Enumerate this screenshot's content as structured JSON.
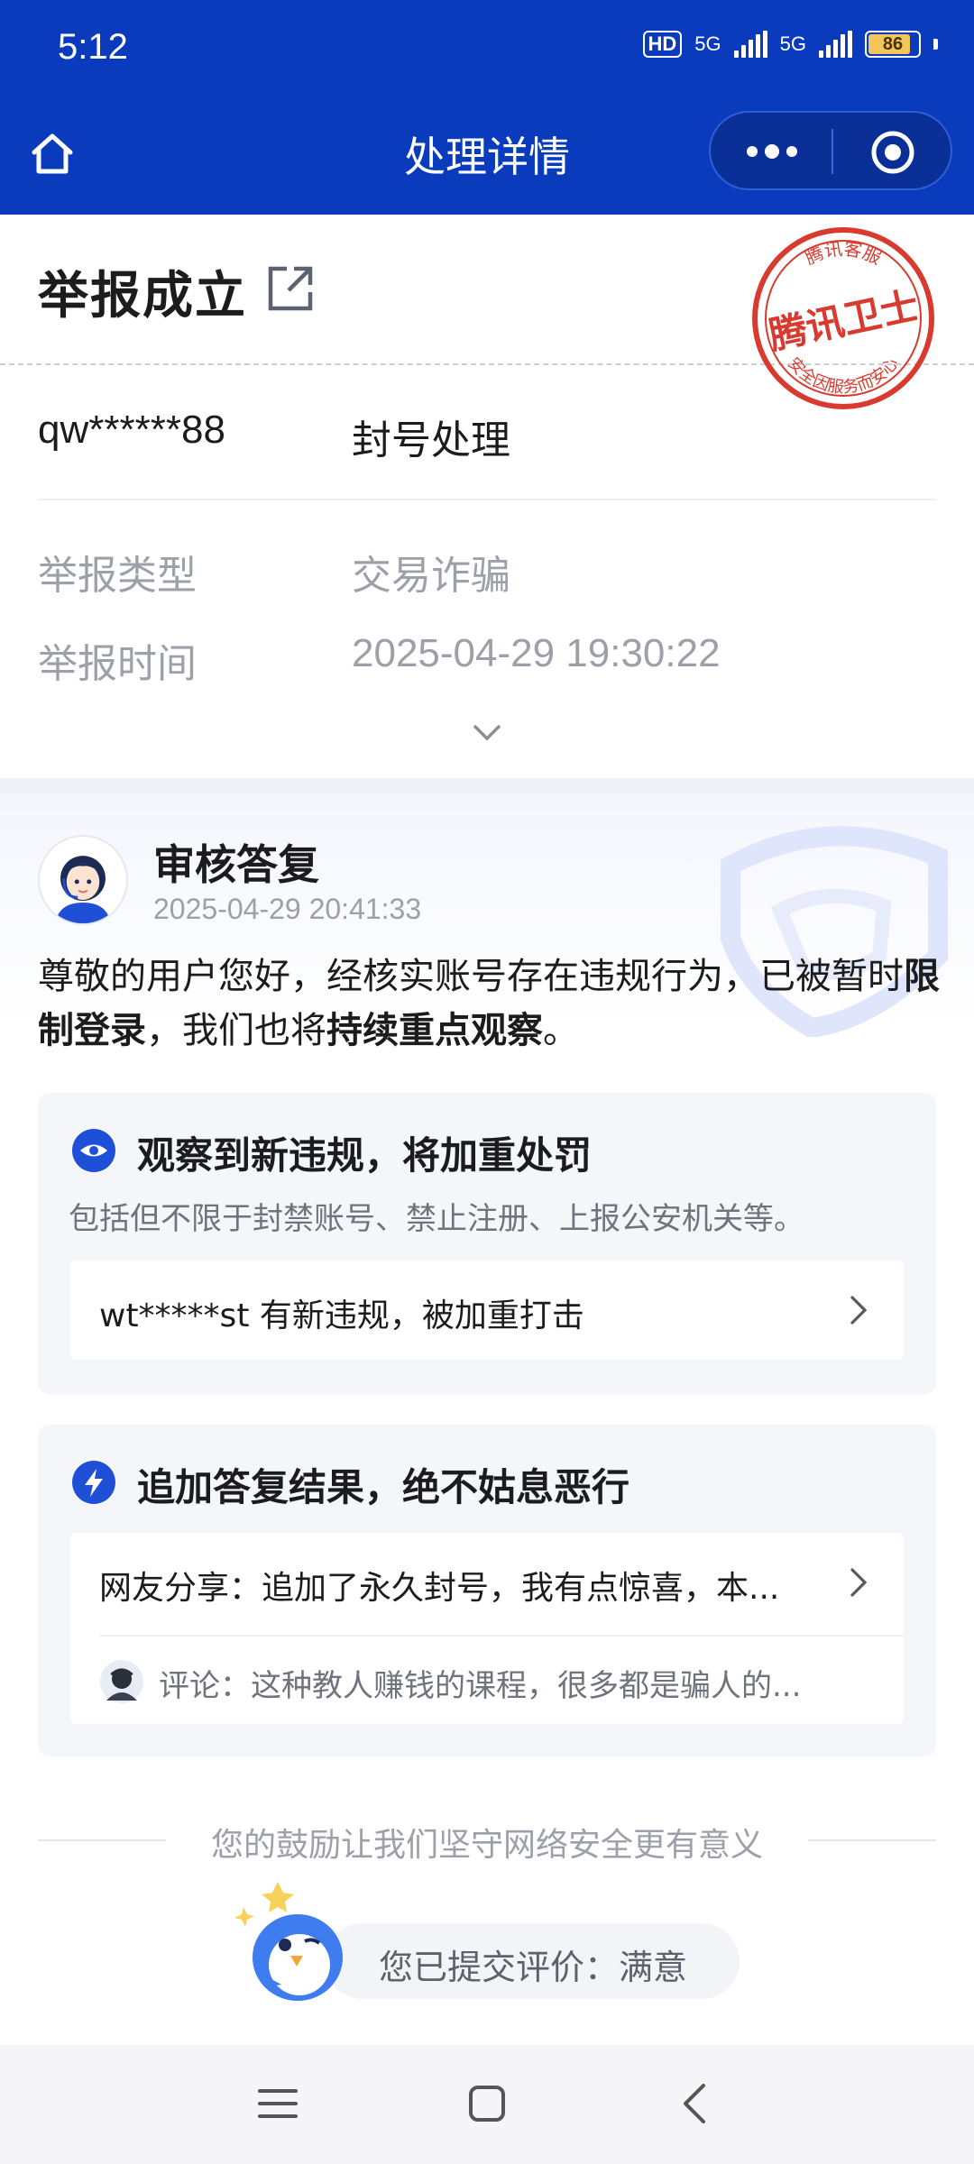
{
  "status_bar": {
    "time": "5:12",
    "hd": "HD",
    "net1": "5G",
    "net2": "5G",
    "battery": "86",
    "battery_level": 0.86
  },
  "nav": {
    "title": "处理详情"
  },
  "header": {
    "title": "举报成立",
    "seal_top": "腾讯客服",
    "seal_main": "腾讯卫士",
    "seal_bottom": "安全因服务而安心",
    "account": "qw******88",
    "action": "封号处理",
    "rows": [
      {
        "label": "举报类型",
        "value": "交易诈骗"
      },
      {
        "label": "举报时间",
        "value": "2025-04-29 19:30:22"
      }
    ]
  },
  "review": {
    "title": "审核答复",
    "time": "2025-04-29 20:41:33",
    "msg_part1": "尊敬的用户您好，经核实账号存在违规行为，已被暂时",
    "msg_bold1": "限制登录",
    "msg_part2": "，我们也将",
    "msg_bold2": "持续重点观察",
    "msg_part3": "。"
  },
  "panel_observe": {
    "title": "观察到新违规，将加重处罚",
    "subtitle": "包括但不限于封禁账号、禁止注册、上报公安机关等。",
    "item": "wt*****st 有新违规，被加重打击"
  },
  "panel_append": {
    "title": "追加答复结果，绝不姑息恶行",
    "share": "网友分享：追加了永久封号，我有点惊喜，本...",
    "comment": "评论：这种教人赚钱的课程，很多都是骗人的..."
  },
  "footer": {
    "encourage": "您的鼓励让我们坚守网络安全更有意义",
    "rating": "您已提交评价：满意"
  },
  "colors": {
    "brand": "#0a3bbd",
    "seal_red": "#d93a2f",
    "accent_blue": "#1e4fd6"
  }
}
